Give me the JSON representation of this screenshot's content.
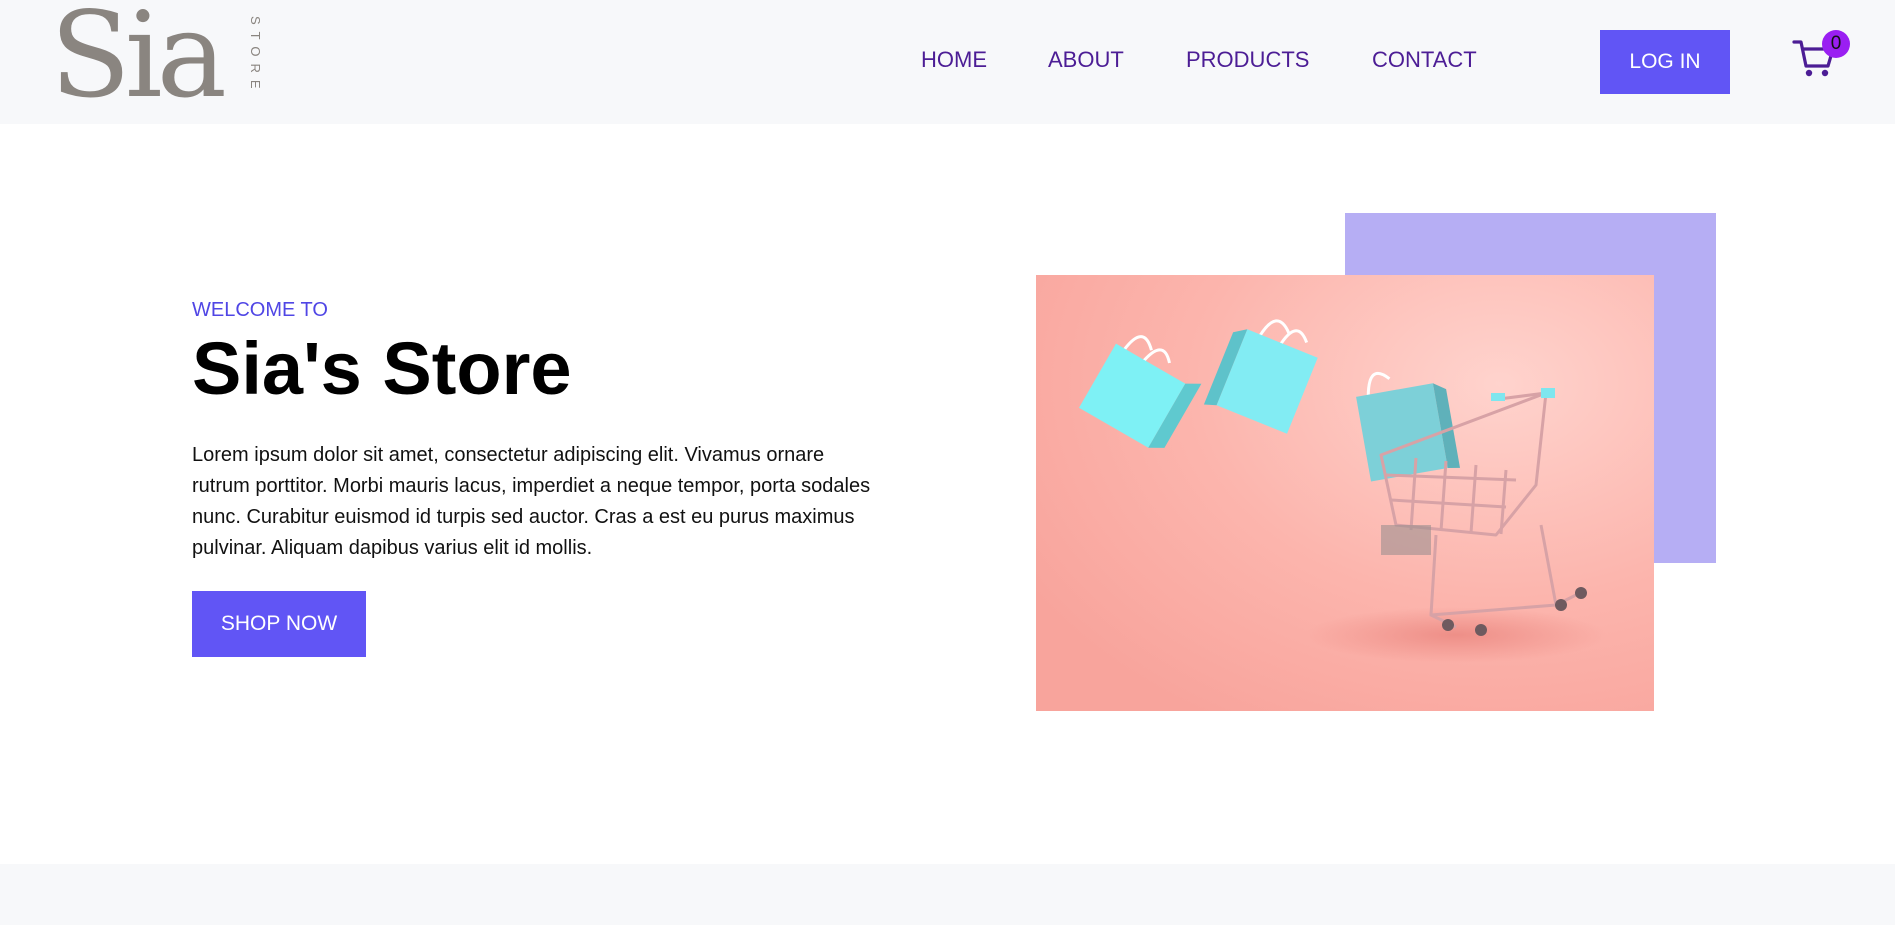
{
  "brand": {
    "logo_text": "Sia",
    "logo_subtext": "STORE"
  },
  "nav": {
    "items": [
      {
        "label": "HOME"
      },
      {
        "label": "ABOUT"
      },
      {
        "label": "PRODUCTS"
      },
      {
        "label": "CONTACT"
      }
    ]
  },
  "header": {
    "login_label": "LOG IN",
    "cart_count": "0"
  },
  "hero": {
    "eyebrow": "WELCOME TO",
    "title": "Sia's Store",
    "description": "Lorem ipsum dolor sit amet, consectetur adipiscing elit. Vivamus ornare rutrum porttitor. Morbi mauris lacus, imperdiet a neque tempor, porta sodales nunc. Curabitur euismod id turpis sed auctor. Cras a est eu purus maximus pulvinar. Aliquam dapibus varius elit id mollis.",
    "cta_label": "SHOP NOW"
  },
  "icons": {
    "cart": "shopping-cart-icon"
  },
  "colors": {
    "accent": "#6155f5",
    "nav_text": "#4c1d95",
    "badge": "#9a1ff2",
    "purple_box": "#b6aef4",
    "image_bg": "#fbb3ac",
    "bags": "#7ee6ee"
  }
}
